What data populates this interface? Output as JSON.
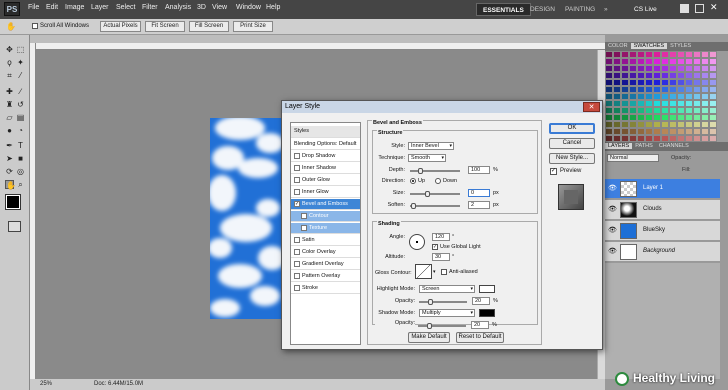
{
  "app": {
    "logo": "PS"
  },
  "menu": [
    "File",
    "Edit",
    "Image",
    "Layer",
    "Select",
    "Filter",
    "Analysis",
    "3D",
    "View",
    "Window",
    "Help"
  ],
  "workspaces": {
    "essentials": "ESSENTIALS",
    "design": "DESIGN",
    "painting": "PAINTING",
    "more": "»",
    "cs_live": "CS Live"
  },
  "options_bar": {
    "scroll_all": "Scroll All Windows",
    "actual_pixels": "Actual Pixels",
    "fit_screen": "Fit Screen",
    "fill_screen": "Fill Screen",
    "print_size": "Print Size"
  },
  "status": {
    "zoom": "25%",
    "doc": "Doc: 6.44M/15.0M"
  },
  "dialog": {
    "title": "Layer Style",
    "close": "✕",
    "styles_header": "Styles",
    "blending": "Blending Options: Default",
    "styles": [
      {
        "label": "Drop Shadow",
        "checked": false
      },
      {
        "label": "Inner Shadow",
        "checked": false
      },
      {
        "label": "Outer Glow",
        "checked": false
      },
      {
        "label": "Inner Glow",
        "checked": false
      },
      {
        "label": "Bevel and Emboss",
        "checked": true
      },
      {
        "label": "Contour",
        "checked": false
      },
      {
        "label": "Texture",
        "checked": false
      },
      {
        "label": "Satin",
        "checked": false
      },
      {
        "label": "Color Overlay",
        "checked": false
      },
      {
        "label": "Gradient Overlay",
        "checked": false
      },
      {
        "label": "Pattern Overlay",
        "checked": false
      },
      {
        "label": "Stroke",
        "checked": false
      }
    ],
    "section_title": "Bevel and Emboss",
    "structure": {
      "title": "Structure",
      "style_label": "Style:",
      "style_value": "Inner Bevel",
      "technique_label": "Technique:",
      "technique_value": "Smooth",
      "depth_label": "Depth:",
      "depth_value": "100",
      "depth_unit": "%",
      "direction_label": "Direction:",
      "up": "Up",
      "down": "Down",
      "size_label": "Size:",
      "size_value": "0",
      "size_unit": "px",
      "soften_label": "Soften:",
      "soften_value": "2",
      "soften_unit": "px"
    },
    "shading": {
      "title": "Shading",
      "angle_label": "Angle:",
      "angle_value": "120",
      "angle_unit": "°",
      "global_light": "Use Global Light",
      "altitude_label": "Altitude:",
      "altitude_value": "30",
      "altitude_unit": "°",
      "gloss_label": "Gloss Contour:",
      "anti_aliased": "Anti-aliased",
      "highlight_label": "Highlight Mode:",
      "highlight_value": "Screen",
      "opacity_label": "Opacity:",
      "highlight_opacity": "20",
      "highlight_opacity_unit": "%",
      "shadow_label": "Shadow Mode:",
      "shadow_value": "Multiply",
      "shadow_opacity": "20",
      "shadow_opacity_unit": "%",
      "highlight_color": "#ffffff",
      "shadow_color": "#000000"
    },
    "make_default": "Make Default",
    "reset_default": "Reset to Default",
    "ok": "OK",
    "cancel": "Cancel",
    "new_style": "New Style...",
    "preview": "Preview"
  },
  "panels": {
    "swatch_tabs": [
      "COLOR",
      "SWATCHES",
      "STYLES"
    ],
    "layer_tabs": [
      "LAYERS",
      "PATHS",
      "CHANNELS"
    ],
    "blend_mode": "Normal",
    "opacity_label": "Opacity:",
    "fill_label": "Fill:",
    "layers": [
      {
        "name": "Layer 1",
        "selected": true
      },
      {
        "name": "Clouds",
        "selected": false
      },
      {
        "name": "BlueSky",
        "selected": false
      },
      {
        "name": "Background",
        "selected": false
      }
    ]
  },
  "watermark": "Healthy Living"
}
